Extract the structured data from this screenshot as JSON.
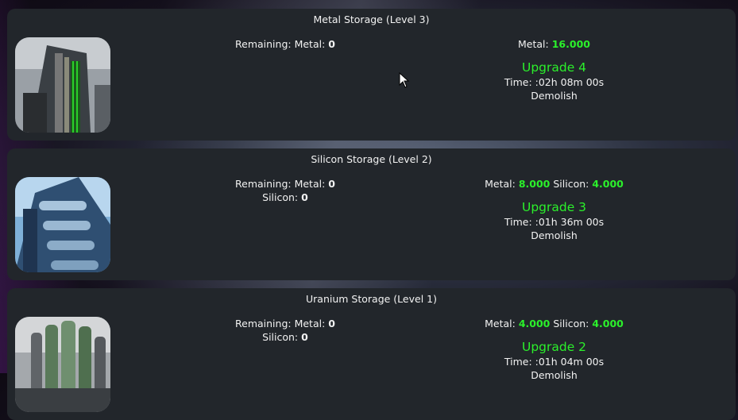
{
  "panels": [
    {
      "title": "Metal Storage (Level 3)",
      "remaining_label": "Remaining:",
      "remaining": [
        {
          "label": "Metal:",
          "value": "0"
        }
      ],
      "cost": [
        {
          "label": "Metal:",
          "value": "16.000"
        }
      ],
      "upgrade": "Upgrade 4",
      "time": "Time: :02h 08m 00s",
      "demolish": "Demolish"
    },
    {
      "title": "Silicon Storage (Level 2)",
      "remaining_label": "Remaining:",
      "remaining": [
        {
          "label": "Metal:",
          "value": "0"
        },
        {
          "label": "Silicon:",
          "value": "0"
        }
      ],
      "cost": [
        {
          "label": "Metal:",
          "value": "8.000"
        },
        {
          "label": "Silicon:",
          "value": "4.000"
        }
      ],
      "upgrade": "Upgrade 3",
      "time": "Time: :01h 36m 00s",
      "demolish": "Demolish"
    },
    {
      "title": "Uranium Storage (Level 1)",
      "remaining_label": "Remaining:",
      "remaining": [
        {
          "label": "Metal:",
          "value": "0"
        },
        {
          "label": "Silicon:",
          "value": "0"
        }
      ],
      "cost": [
        {
          "label": "Metal:",
          "value": "4.000"
        },
        {
          "label": "Silicon:",
          "value": "4.000"
        }
      ],
      "upgrade": "Upgrade 2",
      "time": "Time: :01h 04m 00s",
      "demolish": "Demolish"
    }
  ],
  "colors": {
    "panel": "#22262b",
    "accent": "#2bf02b",
    "text": "#f2f2f2"
  }
}
